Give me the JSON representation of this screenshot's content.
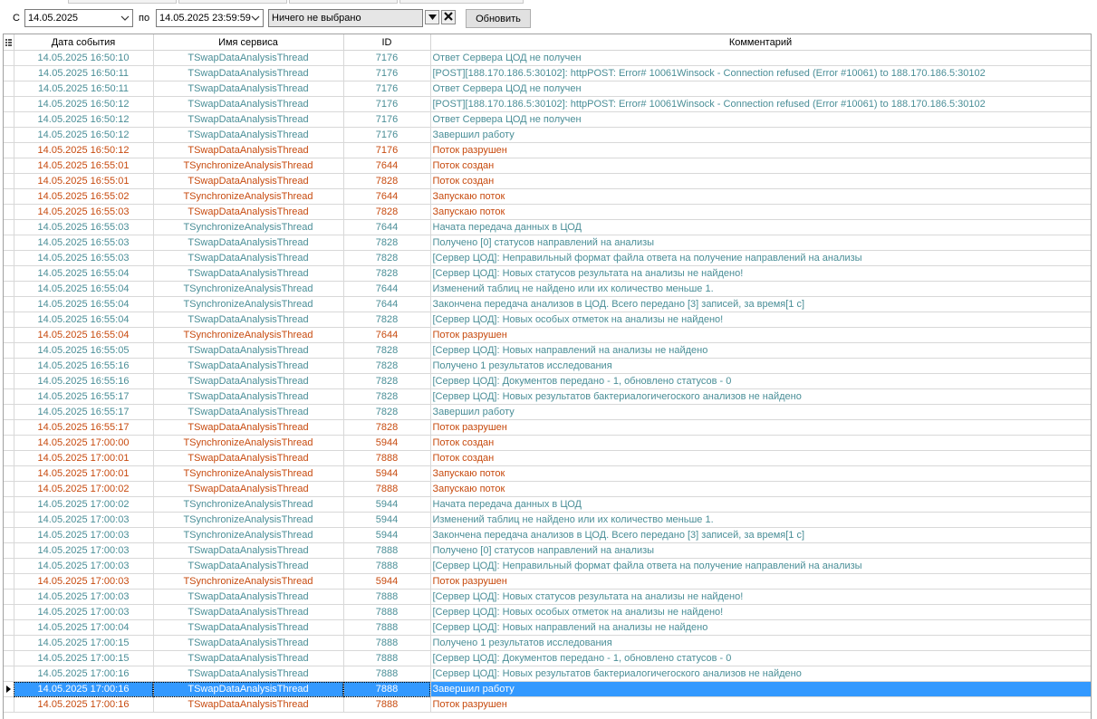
{
  "filter": {
    "from_label": "С",
    "from_date": "14.05.2025",
    "to_label": "по",
    "to_date": "14.05.2025 23:59:59",
    "service_select": "Ничего не выбрано",
    "refresh_label": "Обновить"
  },
  "columns": {
    "date": "Дата события",
    "service": "Имя сервиса",
    "id": "ID",
    "comment": "Комментарий"
  },
  "colors": {
    "info": "#4a8e97",
    "warn": "#c74a0e",
    "selected": "#3399ff"
  },
  "rows": [
    {
      "date": "14.05.2025 16:50:10",
      "service": "TSwapDataAnalysisThread",
      "id": "7176",
      "comment": "Ответ Сервера ЦОД не получен",
      "level": "info"
    },
    {
      "date": "14.05.2025 16:50:11",
      "service": "TSwapDataAnalysisThread",
      "id": "7176",
      "comment": "[POST][188.170.186.5:30102]: httpPOST: Error# 10061Winsock - Connection refused (Error #10061) to 188.170.186.5:30102",
      "level": "info"
    },
    {
      "date": "14.05.2025 16:50:11",
      "service": "TSwapDataAnalysisThread",
      "id": "7176",
      "comment": "Ответ Сервера ЦОД не получен",
      "level": "info"
    },
    {
      "date": "14.05.2025 16:50:12",
      "service": "TSwapDataAnalysisThread",
      "id": "7176",
      "comment": "[POST][188.170.186.5:30102]: httpPOST: Error# 10061Winsock - Connection refused (Error #10061) to 188.170.186.5:30102",
      "level": "info"
    },
    {
      "date": "14.05.2025 16:50:12",
      "service": "TSwapDataAnalysisThread",
      "id": "7176",
      "comment": "Ответ Сервера ЦОД не получен",
      "level": "info"
    },
    {
      "date": "14.05.2025 16:50:12",
      "service": "TSwapDataAnalysisThread",
      "id": "7176",
      "comment": "Завершил работу",
      "level": "info"
    },
    {
      "date": "14.05.2025 16:50:12",
      "service": "TSwapDataAnalysisThread",
      "id": "7176",
      "comment": "Поток разрушен",
      "level": "warn"
    },
    {
      "date": "14.05.2025 16:55:01",
      "service": "TSynchronizeAnalysisThread",
      "id": "7644",
      "comment": "Поток создан",
      "level": "warn"
    },
    {
      "date": "14.05.2025 16:55:01",
      "service": "TSwapDataAnalysisThread",
      "id": "7828",
      "comment": "Поток создан",
      "level": "warn"
    },
    {
      "date": "14.05.2025 16:55:02",
      "service": "TSynchronizeAnalysisThread",
      "id": "7644",
      "comment": "Запускаю поток",
      "level": "warn"
    },
    {
      "date": "14.05.2025 16:55:03",
      "service": "TSwapDataAnalysisThread",
      "id": "7828",
      "comment": "Запускаю поток",
      "level": "warn"
    },
    {
      "date": "14.05.2025 16:55:03",
      "service": "TSynchronizeAnalysisThread",
      "id": "7644",
      "comment": "Начата передача данных в ЦОД",
      "level": "info"
    },
    {
      "date": "14.05.2025 16:55:03",
      "service": "TSwapDataAnalysisThread",
      "id": "7828",
      "comment": "Получено [0] статусов направлений на анализы",
      "level": "info"
    },
    {
      "date": "14.05.2025 16:55:03",
      "service": "TSwapDataAnalysisThread",
      "id": "7828",
      "comment": "[Сервер ЦОД]: Неправильный формат файла ответа на получение направлений на анализы",
      "level": "info"
    },
    {
      "date": "14.05.2025 16:55:04",
      "service": "TSwapDataAnalysisThread",
      "id": "7828",
      "comment": "[Сервер ЦОД]: Новых статусов результата на анализы не найдено!",
      "level": "info"
    },
    {
      "date": "14.05.2025 16:55:04",
      "service": "TSynchronizeAnalysisThread",
      "id": "7644",
      "comment": "Изменений таблиц не найдено или их количество меньше 1.",
      "level": "info"
    },
    {
      "date": "14.05.2025 16:55:04",
      "service": "TSynchronizeAnalysisThread",
      "id": "7644",
      "comment": "Закончена передача анализов в ЦОД. Всего передано [3] записей, за время[1 с]",
      "level": "info"
    },
    {
      "date": "14.05.2025 16:55:04",
      "service": "TSwapDataAnalysisThread",
      "id": "7828",
      "comment": "[Сервер ЦОД]: Новых особых отметок на анализы не найдено!",
      "level": "info"
    },
    {
      "date": "14.05.2025 16:55:04",
      "service": "TSynchronizeAnalysisThread",
      "id": "7644",
      "comment": "Поток разрушен",
      "level": "warn"
    },
    {
      "date": "14.05.2025 16:55:05",
      "service": "TSwapDataAnalysisThread",
      "id": "7828",
      "comment": "[Сервер ЦОД]: Новых направлений на анализы не найдено",
      "level": "info"
    },
    {
      "date": "14.05.2025 16:55:16",
      "service": "TSwapDataAnalysisThread",
      "id": "7828",
      "comment": "Получено 1 результатов исследования",
      "level": "info"
    },
    {
      "date": "14.05.2025 16:55:16",
      "service": "TSwapDataAnalysisThread",
      "id": "7828",
      "comment": "[Сервер ЦОД]: Документов передано - 1, обновлено статусов - 0",
      "level": "info"
    },
    {
      "date": "14.05.2025 16:55:17",
      "service": "TSwapDataAnalysisThread",
      "id": "7828",
      "comment": "[Сервер ЦОД]: Новых результатов бактериалогичегоского анализов не найдено",
      "level": "info"
    },
    {
      "date": "14.05.2025 16:55:17",
      "service": "TSwapDataAnalysisThread",
      "id": "7828",
      "comment": "Завершил работу",
      "level": "info"
    },
    {
      "date": "14.05.2025 16:55:17",
      "service": "TSwapDataAnalysisThread",
      "id": "7828",
      "comment": "Поток разрушен",
      "level": "warn"
    },
    {
      "date": "14.05.2025 17:00:00",
      "service": "TSynchronizeAnalysisThread",
      "id": "5944",
      "comment": "Поток создан",
      "level": "warn"
    },
    {
      "date": "14.05.2025 17:00:01",
      "service": "TSwapDataAnalysisThread",
      "id": "7888",
      "comment": "Поток создан",
      "level": "warn"
    },
    {
      "date": "14.05.2025 17:00:01",
      "service": "TSynchronizeAnalysisThread",
      "id": "5944",
      "comment": "Запускаю поток",
      "level": "warn"
    },
    {
      "date": "14.05.2025 17:00:02",
      "service": "TSwapDataAnalysisThread",
      "id": "7888",
      "comment": "Запускаю поток",
      "level": "warn"
    },
    {
      "date": "14.05.2025 17:00:02",
      "service": "TSynchronizeAnalysisThread",
      "id": "5944",
      "comment": "Начата передача данных в ЦОД",
      "level": "info"
    },
    {
      "date": "14.05.2025 17:00:03",
      "service": "TSynchronizeAnalysisThread",
      "id": "5944",
      "comment": "Изменений таблиц не найдено или их количество меньше 1.",
      "level": "info"
    },
    {
      "date": "14.05.2025 17:00:03",
      "service": "TSynchronizeAnalysisThread",
      "id": "5944",
      "comment": "Закончена передача анализов в ЦОД. Всего передано [3] записей, за время[1 с]",
      "level": "info"
    },
    {
      "date": "14.05.2025 17:00:03",
      "service": "TSwapDataAnalysisThread",
      "id": "7888",
      "comment": "Получено [0] статусов направлений на анализы",
      "level": "info"
    },
    {
      "date": "14.05.2025 17:00:03",
      "service": "TSwapDataAnalysisThread",
      "id": "7888",
      "comment": "[Сервер ЦОД]: Неправильный формат файла ответа на получение направлений на анализы",
      "level": "info"
    },
    {
      "date": "14.05.2025 17:00:03",
      "service": "TSynchronizeAnalysisThread",
      "id": "5944",
      "comment": "Поток разрушен",
      "level": "warn"
    },
    {
      "date": "14.05.2025 17:00:03",
      "service": "TSwapDataAnalysisThread",
      "id": "7888",
      "comment": "[Сервер ЦОД]: Новых статусов результата на анализы не найдено!",
      "level": "info"
    },
    {
      "date": "14.05.2025 17:00:03",
      "service": "TSwapDataAnalysisThread",
      "id": "7888",
      "comment": "[Сервер ЦОД]: Новых особых отметок на анализы не найдено!",
      "level": "info"
    },
    {
      "date": "14.05.2025 17:00:04",
      "service": "TSwapDataAnalysisThread",
      "id": "7888",
      "comment": "[Сервер ЦОД]: Новых направлений на анализы не найдено",
      "level": "info"
    },
    {
      "date": "14.05.2025 17:00:15",
      "service": "TSwapDataAnalysisThread",
      "id": "7888",
      "comment": "Получено 1 результатов исследования",
      "level": "info"
    },
    {
      "date": "14.05.2025 17:00:15",
      "service": "TSwapDataAnalysisThread",
      "id": "7888",
      "comment": "[Сервер ЦОД]: Документов передано - 1, обновлено статусов - 0",
      "level": "info"
    },
    {
      "date": "14.05.2025 17:00:16",
      "service": "TSwapDataAnalysisThread",
      "id": "7888",
      "comment": "[Сервер ЦОД]: Новых результатов бактериалогичегоского анализов не найдено",
      "level": "info"
    },
    {
      "date": "14.05.2025 17:00:16",
      "service": "TSwapDataAnalysisThread",
      "id": "7888",
      "comment": "Завершил работу",
      "level": "info",
      "selected": true
    },
    {
      "date": "14.05.2025 17:00:16",
      "service": "TSwapDataAnalysisThread",
      "id": "7888",
      "comment": "Поток разрушен",
      "level": "warn"
    }
  ]
}
